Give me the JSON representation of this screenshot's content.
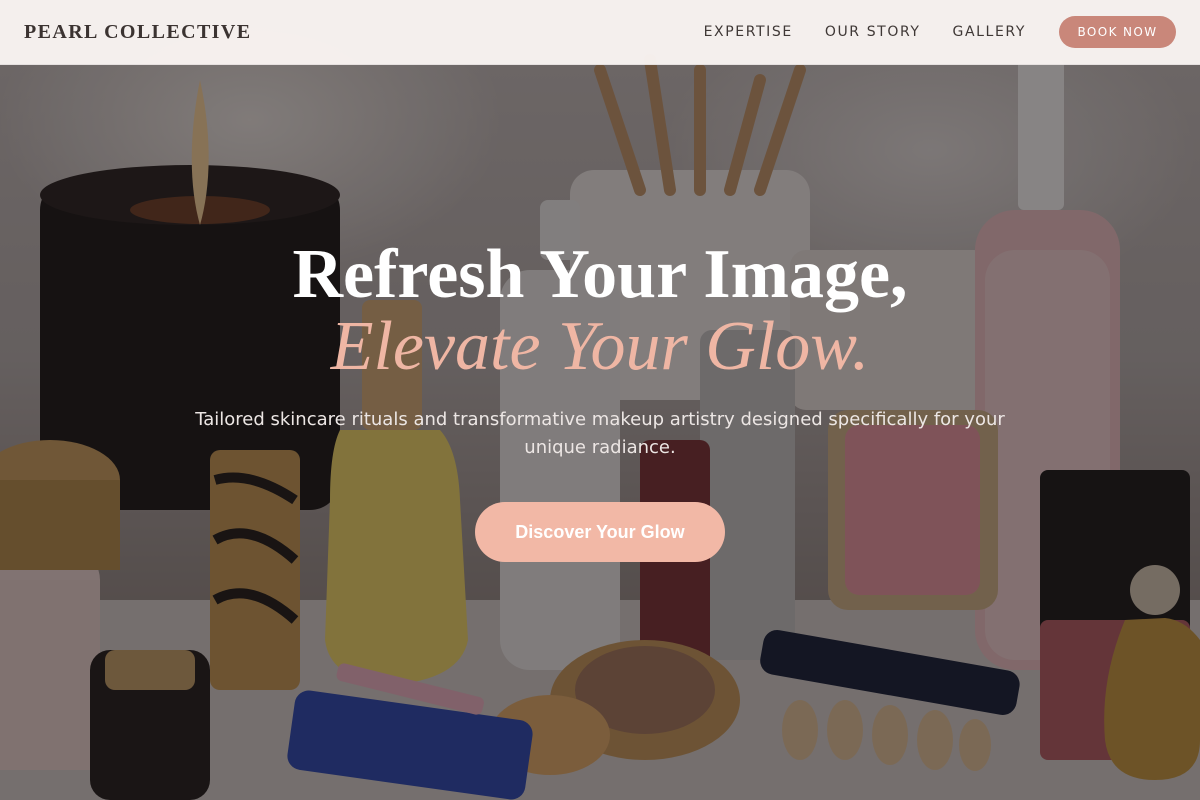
{
  "header": {
    "brand": "PEARL COLLECTIVE",
    "nav": [
      {
        "label": "EXPERTISE"
      },
      {
        "label": "OUR STORY"
      },
      {
        "label": "GALLERY"
      }
    ],
    "book_label": "BOOK NOW"
  },
  "hero": {
    "headline": "Refresh Your Image,",
    "headline_accent": "Elevate Your Glow.",
    "subhead": "Tailored skincare rituals and transformative makeup artistry designed specifically for your unique radiance.",
    "cta_label": "Discover Your Glow"
  },
  "colors": {
    "accent": "#c9877a",
    "cta": "#f2b8a6",
    "headline_accent": "#efb6a4",
    "header_bg": "#faf5f2"
  }
}
